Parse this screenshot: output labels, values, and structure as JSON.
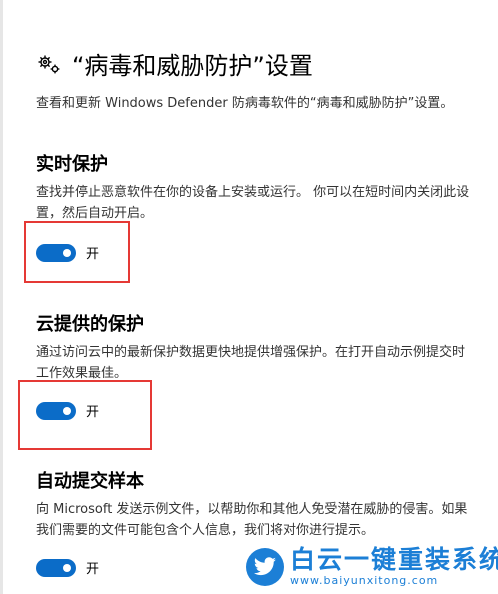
{
  "header": {
    "title": "“病毒和威胁防护”设置",
    "description": "查看和更新 Windows Defender 防病毒软件的“病毒和威胁防护”设置。",
    "icon": "gears-icon"
  },
  "sections": [
    {
      "title": "实时保护",
      "description": "查找并停止恶意软件在你的设备上安装或运行。 你可以在短时间内关闭此设置，然后自动开启。",
      "toggle_label": "开",
      "toggle_on": true
    },
    {
      "title": "云提供的保护",
      "description": "通过访问云中的最新保护数据更快地提供增强保护。在打开自动示例提交时工作效果最佳。",
      "toggle_label": "开",
      "toggle_on": true
    },
    {
      "title": "自动提交样本",
      "description": "向 Microsoft 发送示例文件，以帮助你和其他人免受潜在威胁的侵害。如果我们需要的文件可能包含个人信息，我们将对你进行提示。",
      "toggle_label": "开",
      "toggle_on": true
    }
  ],
  "watermark": {
    "brand": "白云一键重装系统",
    "url": "www.baiyunxitong.com"
  },
  "colors": {
    "toggle_on": "#0b6cc8",
    "highlight": "#e53935",
    "watermark": "#1c7fd6"
  }
}
